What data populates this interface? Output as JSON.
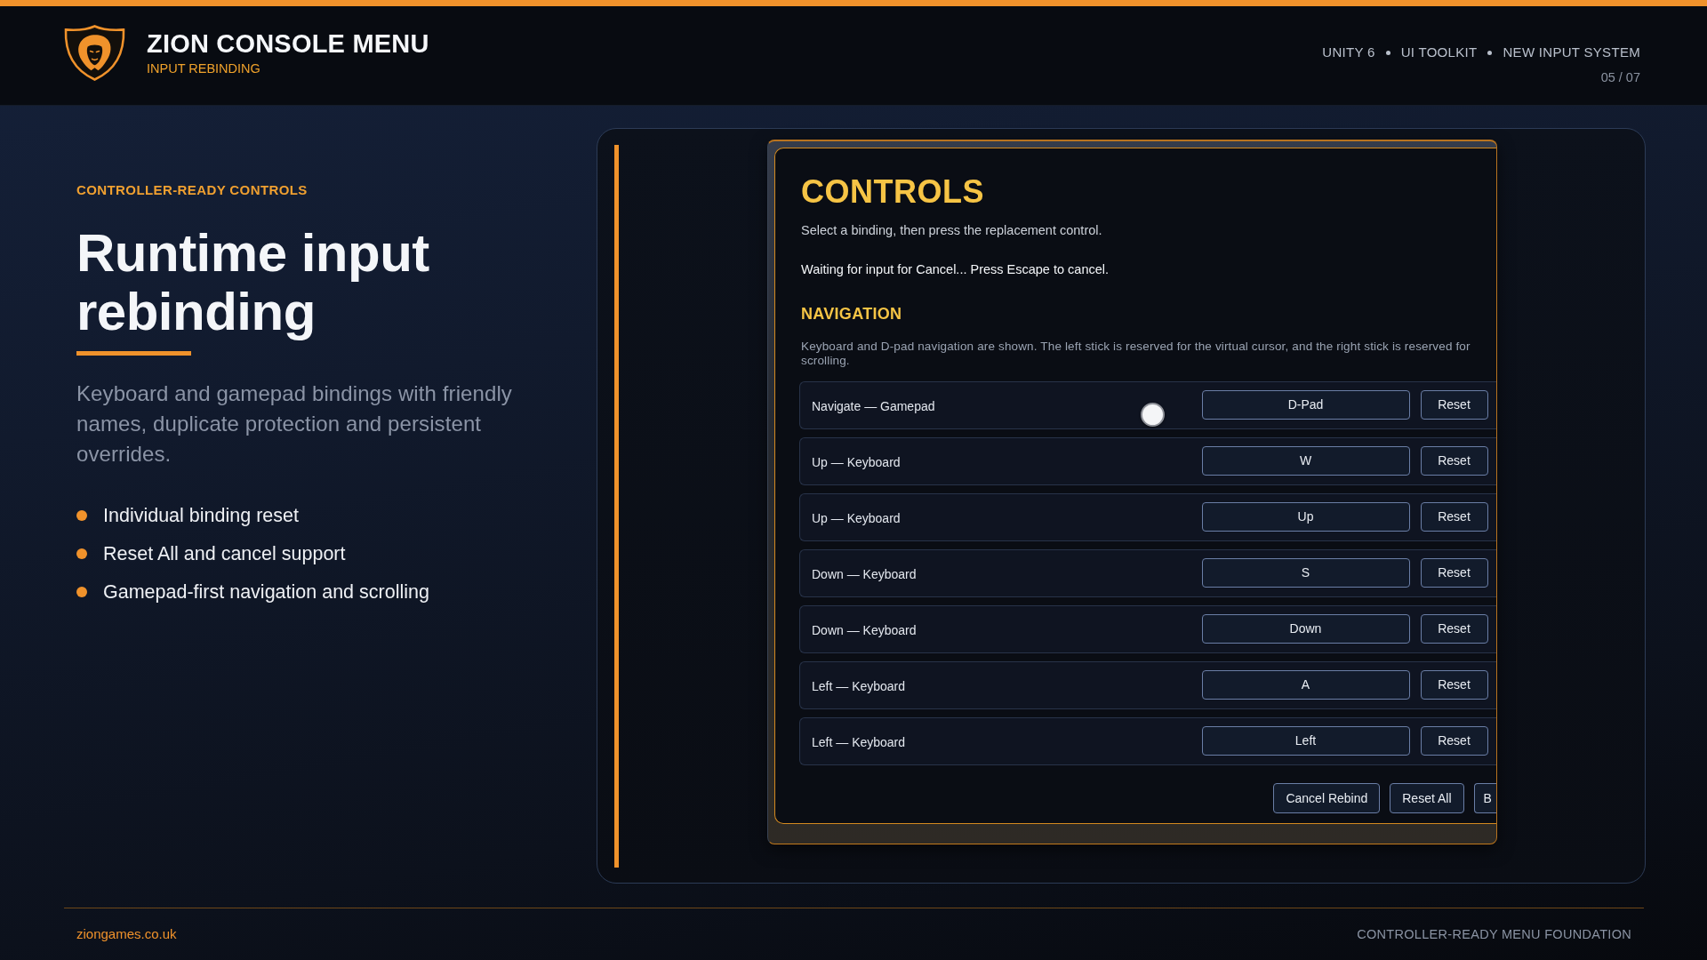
{
  "header": {
    "title": "ZION CONSOLE MENU",
    "subtitle": "INPUT REBINDING",
    "tags": [
      "UNITY 6",
      "UI TOOLKIT",
      "NEW INPUT SYSTEM"
    ],
    "page": "05 / 07"
  },
  "hero": {
    "eyebrow": "CONTROLLER-READY CONTROLS",
    "heading": "Runtime input rebinding",
    "description": "Keyboard and gamepad bindings with friendly names, duplicate protection and persistent overrides.",
    "features": [
      "Individual binding reset",
      "Reset All and cancel support",
      "Gamepad-first navigation and scrolling"
    ]
  },
  "controls_window": {
    "title": "CONTROLS",
    "instruction": "Select a binding, then press the replacement control.",
    "status": "Waiting for input for Cancel... Press Escape to cancel.",
    "section": {
      "title": "NAVIGATION",
      "description": "Keyboard and D-pad navigation are shown. The left stick is reserved for the virtual cursor, and the right stick is reserved for scrolling."
    },
    "bindings": [
      {
        "action": "Navigate — Gamepad",
        "binding": "D-Pad",
        "reset": "Reset"
      },
      {
        "action": "Up — Keyboard",
        "binding": "W",
        "reset": "Reset"
      },
      {
        "action": "Up — Keyboard",
        "binding": "Up",
        "reset": "Reset"
      },
      {
        "action": "Down — Keyboard",
        "binding": "S",
        "reset": "Reset"
      },
      {
        "action": "Down — Keyboard",
        "binding": "Down",
        "reset": "Reset"
      },
      {
        "action": "Left — Keyboard",
        "binding": "A",
        "reset": "Reset"
      },
      {
        "action": "Left — Keyboard",
        "binding": "Left",
        "reset": "Reset"
      }
    ],
    "actions": [
      {
        "label": "Cancel Rebind",
        "clipped": false
      },
      {
        "label": "Reset All",
        "clipped": false
      },
      {
        "label": "B",
        "clipped": true
      }
    ]
  },
  "footer": {
    "site": "ziongames.co.uk",
    "caption": "CONTROLLER-READY MENU FOUNDATION"
  }
}
